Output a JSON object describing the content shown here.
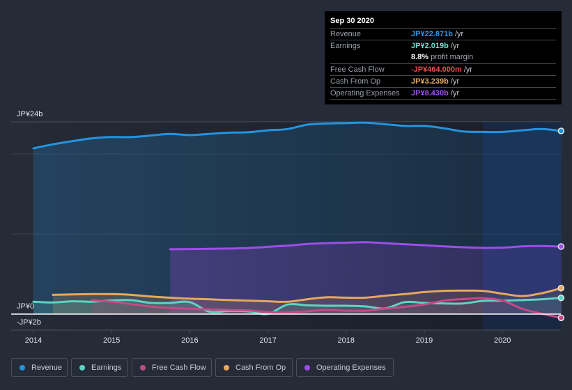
{
  "tooltip": {
    "date": "Sep 30 2020",
    "rows": [
      {
        "label": "Revenue",
        "value": "JP¥22.871b",
        "unit": " /yr",
        "color": "#2d9ae6"
      },
      {
        "label": "Earnings",
        "value": "JP¥2.019b",
        "unit": " /yr",
        "color": "#6ee0d1",
        "sub_value": "8.8%",
        "sub_text": " profit margin"
      },
      {
        "label": "Free Cash Flow",
        "value": "-JP¥464.000m",
        "unit": " /yr",
        "color": "#f04d4d"
      },
      {
        "label": "Cash From Op",
        "value": "JP¥3.239b",
        "unit": " /yr",
        "color": "#e8aa5c"
      },
      {
        "label": "Operating Expenses",
        "value": "JP¥8.430b",
        "unit": " /yr",
        "color": "#a04ff0"
      }
    ]
  },
  "legend": {
    "items": [
      {
        "label": "Revenue",
        "color": "#2394df"
      },
      {
        "label": "Earnings",
        "color": "#5fd3c3"
      },
      {
        "label": "Free Cash Flow",
        "color": "#c44a86"
      },
      {
        "label": "Cash From Op",
        "color": "#e6a85e"
      },
      {
        "label": "Operating Expenses",
        "color": "#9d4ee8"
      }
    ]
  },
  "chart_data": {
    "type": "area",
    "title": "",
    "xlabel": "",
    "ylabel": "",
    "units": "JP¥ billions",
    "xlim": [
      2013.71,
      2020.75
    ],
    "ylim": [
      -2,
      24
    ],
    "x_ticks": [
      2014,
      2015,
      2016,
      2017,
      2018,
      2019,
      2020
    ],
    "x_tick_labels": [
      "2014",
      "2015",
      "2016",
      "2017",
      "2018",
      "2019",
      "2020"
    ],
    "y_tick_values": [
      24,
      0,
      -2
    ],
    "y_tick_labels": [
      "JP¥24b",
      "JP¥0",
      "-JP¥2b"
    ],
    "grid": true,
    "gridline_values": [
      24,
      20,
      10
    ],
    "highlight_range": [
      2019.75,
      2020.75
    ],
    "legend_position": "bottom-left",
    "x": [
      2014.0,
      2014.25,
      2014.5,
      2014.75,
      2015.0,
      2015.25,
      2015.5,
      2015.75,
      2016.0,
      2016.25,
      2016.5,
      2016.75,
      2017.0,
      2017.25,
      2017.5,
      2017.75,
      2018.0,
      2018.25,
      2018.5,
      2018.75,
      2019.0,
      2019.25,
      2019.5,
      2019.75,
      2020.0,
      2020.25,
      2020.5,
      2020.75
    ],
    "series": [
      {
        "name": "Revenue",
        "color": "#2394df",
        "values": [
          20.7,
          21.2,
          21.6,
          21.95,
          22.1,
          22.1,
          22.3,
          22.5,
          22.35,
          22.5,
          22.65,
          22.7,
          22.95,
          23.1,
          23.65,
          23.8,
          23.85,
          23.9,
          23.7,
          23.5,
          23.5,
          23.2,
          22.8,
          22.75,
          22.75,
          22.95,
          23.1,
          22.871
        ]
      },
      {
        "name": "Earnings",
        "color": "#5fd3c3",
        "values": [
          1.54,
          1.45,
          1.6,
          1.55,
          1.7,
          1.74,
          1.4,
          1.39,
          1.5,
          0.3,
          0.4,
          0.35,
          0.03,
          1.19,
          1.1,
          1.04,
          1.04,
          0.96,
          0.7,
          1.5,
          1.39,
          1.33,
          1.33,
          1.65,
          1.68,
          1.75,
          1.85,
          2.019
        ]
      },
      {
        "name": "Free Cash Flow",
        "color": "#c44a86",
        "values": [
          null,
          null,
          null,
          1.74,
          1.54,
          1.25,
          0.95,
          0.76,
          0.67,
          0.58,
          0.52,
          0.45,
          0.25,
          0.2,
          0.35,
          0.52,
          0.43,
          0.43,
          0.67,
          0.9,
          1.2,
          1.68,
          1.88,
          1.97,
          1.7,
          0.67,
          0.05,
          -0.464
        ]
      },
      {
        "name": "Cash From Op",
        "color": "#e6a85e",
        "values": [
          null,
          2.4,
          2.46,
          2.5,
          2.5,
          2.4,
          2.2,
          2.05,
          1.92,
          1.85,
          1.75,
          1.68,
          1.6,
          1.54,
          1.85,
          2.1,
          2.05,
          2.05,
          2.3,
          2.5,
          2.75,
          2.9,
          2.93,
          2.9,
          2.55,
          2.25,
          2.6,
          3.239
        ]
      },
      {
        "name": "Operating Expenses",
        "color": "#9d4ee8",
        "values": [
          null,
          null,
          null,
          null,
          null,
          null,
          null,
          8.1,
          8.12,
          8.15,
          8.18,
          8.25,
          8.4,
          8.55,
          8.75,
          8.85,
          8.92,
          8.97,
          8.85,
          8.72,
          8.6,
          8.45,
          8.35,
          8.27,
          8.3,
          8.45,
          8.5,
          8.43
        ]
      }
    ]
  }
}
